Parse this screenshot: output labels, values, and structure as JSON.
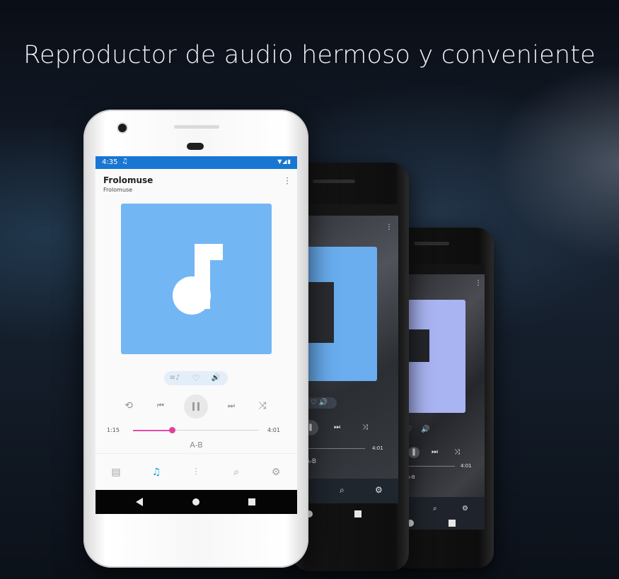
{
  "headline": "Reproductor de audio hermoso y conveniente",
  "main_phone": {
    "status": {
      "time": "4:35",
      "note_icon": "music-note-icon",
      "sys_icons": "▼◢▮"
    },
    "app": {
      "title": "Frolomuse",
      "subtitle": "Frolomuse",
      "menu": "⋮"
    },
    "quick_actions": [
      {
        "name": "lyrics-icon",
        "glyph": "≡♪"
      },
      {
        "name": "heart-icon",
        "glyph": "♡"
      },
      {
        "name": "volume-icon",
        "glyph": "🔊"
      }
    ],
    "controls": {
      "repeat": "⟲",
      "previous": "⏮",
      "next": "⏭",
      "shuffle": "⤨"
    },
    "progress": {
      "current": "1:15",
      "total": "4:01",
      "fraction": 0.31
    },
    "ab_label": "A-B",
    "bottom_nav": [
      {
        "name": "library-icon",
        "glyph": "▤",
        "active": false
      },
      {
        "name": "player-icon",
        "glyph": "♫",
        "active": true
      },
      {
        "name": "equalizer-icon",
        "glyph": "⫶",
        "active": false
      },
      {
        "name": "search-icon",
        "glyph": "⌕",
        "active": false
      },
      {
        "name": "settings-icon",
        "glyph": "⚙",
        "active": false
      }
    ],
    "colors": {
      "status_bar": "#1976d2",
      "album_art": "#73b6f4",
      "progress": "#e64aa8",
      "active_nav": "#1a9bd7"
    }
  },
  "phone2": {
    "progress_total": "4:01",
    "ab_label": "A-B",
    "album_color": "#6aaef0"
  },
  "phone3": {
    "progress_total": "4:01",
    "ab_label": "A-B",
    "album_color": "#a9b4f2"
  }
}
